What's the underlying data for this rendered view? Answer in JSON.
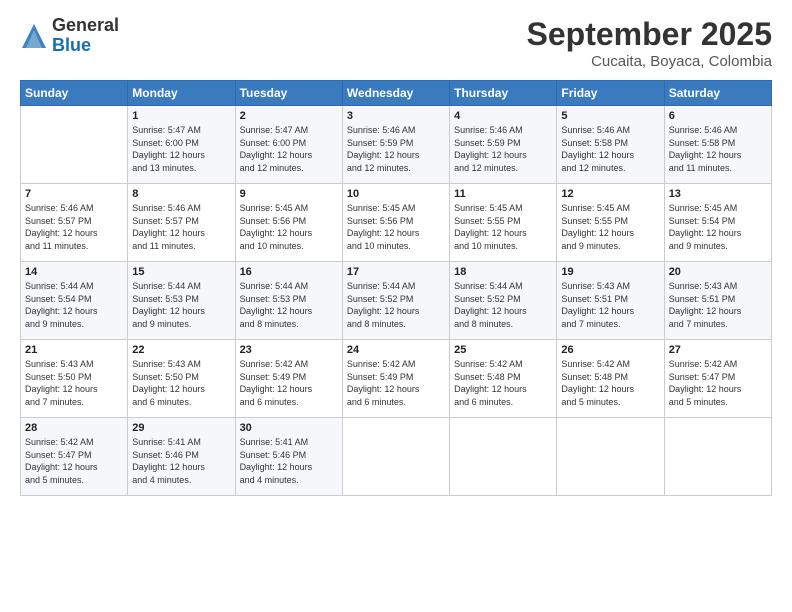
{
  "header": {
    "logo": {
      "general": "General",
      "blue": "Blue"
    },
    "title": "September 2025",
    "subtitle": "Cucaita, Boyaca, Colombia"
  },
  "calendar": {
    "days_of_week": [
      "Sunday",
      "Monday",
      "Tuesday",
      "Wednesday",
      "Thursday",
      "Friday",
      "Saturday"
    ],
    "weeks": [
      [
        {
          "day": "",
          "content": ""
        },
        {
          "day": "1",
          "content": "Sunrise: 5:47 AM\nSunset: 6:00 PM\nDaylight: 12 hours\nand 13 minutes."
        },
        {
          "day": "2",
          "content": "Sunrise: 5:47 AM\nSunset: 6:00 PM\nDaylight: 12 hours\nand 12 minutes."
        },
        {
          "day": "3",
          "content": "Sunrise: 5:46 AM\nSunset: 5:59 PM\nDaylight: 12 hours\nand 12 minutes."
        },
        {
          "day": "4",
          "content": "Sunrise: 5:46 AM\nSunset: 5:59 PM\nDaylight: 12 hours\nand 12 minutes."
        },
        {
          "day": "5",
          "content": "Sunrise: 5:46 AM\nSunset: 5:58 PM\nDaylight: 12 hours\nand 12 minutes."
        },
        {
          "day": "6",
          "content": "Sunrise: 5:46 AM\nSunset: 5:58 PM\nDaylight: 12 hours\nand 11 minutes."
        }
      ],
      [
        {
          "day": "7",
          "content": "Sunrise: 5:46 AM\nSunset: 5:57 PM\nDaylight: 12 hours\nand 11 minutes."
        },
        {
          "day": "8",
          "content": "Sunrise: 5:46 AM\nSunset: 5:57 PM\nDaylight: 12 hours\nand 11 minutes."
        },
        {
          "day": "9",
          "content": "Sunrise: 5:45 AM\nSunset: 5:56 PM\nDaylight: 12 hours\nand 10 minutes."
        },
        {
          "day": "10",
          "content": "Sunrise: 5:45 AM\nSunset: 5:56 PM\nDaylight: 12 hours\nand 10 minutes."
        },
        {
          "day": "11",
          "content": "Sunrise: 5:45 AM\nSunset: 5:55 PM\nDaylight: 12 hours\nand 10 minutes."
        },
        {
          "day": "12",
          "content": "Sunrise: 5:45 AM\nSunset: 5:55 PM\nDaylight: 12 hours\nand 9 minutes."
        },
        {
          "day": "13",
          "content": "Sunrise: 5:45 AM\nSunset: 5:54 PM\nDaylight: 12 hours\nand 9 minutes."
        }
      ],
      [
        {
          "day": "14",
          "content": "Sunrise: 5:44 AM\nSunset: 5:54 PM\nDaylight: 12 hours\nand 9 minutes."
        },
        {
          "day": "15",
          "content": "Sunrise: 5:44 AM\nSunset: 5:53 PM\nDaylight: 12 hours\nand 9 minutes."
        },
        {
          "day": "16",
          "content": "Sunrise: 5:44 AM\nSunset: 5:53 PM\nDaylight: 12 hours\nand 8 minutes."
        },
        {
          "day": "17",
          "content": "Sunrise: 5:44 AM\nSunset: 5:52 PM\nDaylight: 12 hours\nand 8 minutes."
        },
        {
          "day": "18",
          "content": "Sunrise: 5:44 AM\nSunset: 5:52 PM\nDaylight: 12 hours\nand 8 minutes."
        },
        {
          "day": "19",
          "content": "Sunrise: 5:43 AM\nSunset: 5:51 PM\nDaylight: 12 hours\nand 7 minutes."
        },
        {
          "day": "20",
          "content": "Sunrise: 5:43 AM\nSunset: 5:51 PM\nDaylight: 12 hours\nand 7 minutes."
        }
      ],
      [
        {
          "day": "21",
          "content": "Sunrise: 5:43 AM\nSunset: 5:50 PM\nDaylight: 12 hours\nand 7 minutes."
        },
        {
          "day": "22",
          "content": "Sunrise: 5:43 AM\nSunset: 5:50 PM\nDaylight: 12 hours\nand 6 minutes."
        },
        {
          "day": "23",
          "content": "Sunrise: 5:42 AM\nSunset: 5:49 PM\nDaylight: 12 hours\nand 6 minutes."
        },
        {
          "day": "24",
          "content": "Sunrise: 5:42 AM\nSunset: 5:49 PM\nDaylight: 12 hours\nand 6 minutes."
        },
        {
          "day": "25",
          "content": "Sunrise: 5:42 AM\nSunset: 5:48 PM\nDaylight: 12 hours\nand 6 minutes."
        },
        {
          "day": "26",
          "content": "Sunrise: 5:42 AM\nSunset: 5:48 PM\nDaylight: 12 hours\nand 5 minutes."
        },
        {
          "day": "27",
          "content": "Sunrise: 5:42 AM\nSunset: 5:47 PM\nDaylight: 12 hours\nand 5 minutes."
        }
      ],
      [
        {
          "day": "28",
          "content": "Sunrise: 5:42 AM\nSunset: 5:47 PM\nDaylight: 12 hours\nand 5 minutes."
        },
        {
          "day": "29",
          "content": "Sunrise: 5:41 AM\nSunset: 5:46 PM\nDaylight: 12 hours\nand 4 minutes."
        },
        {
          "day": "30",
          "content": "Sunrise: 5:41 AM\nSunset: 5:46 PM\nDaylight: 12 hours\nand 4 minutes."
        },
        {
          "day": "",
          "content": ""
        },
        {
          "day": "",
          "content": ""
        },
        {
          "day": "",
          "content": ""
        },
        {
          "day": "",
          "content": ""
        }
      ]
    ]
  }
}
